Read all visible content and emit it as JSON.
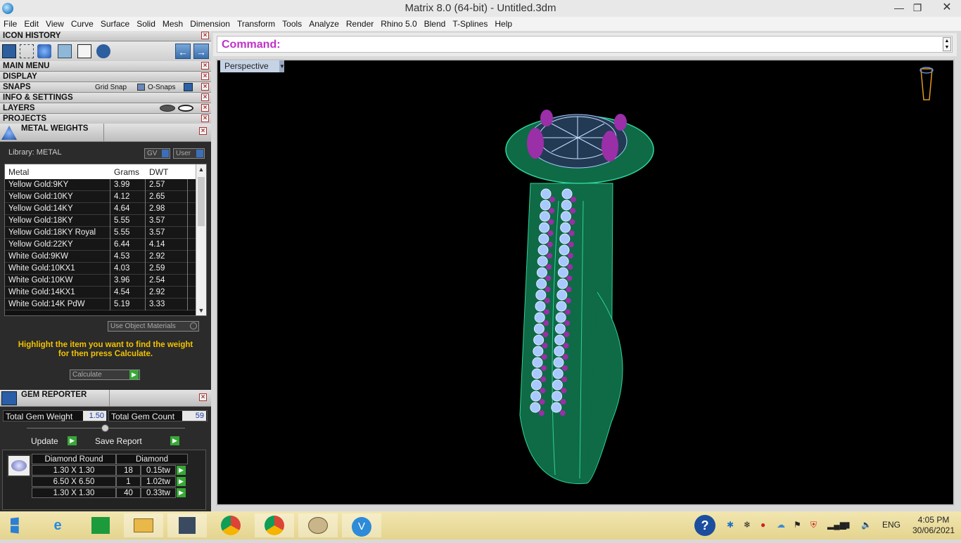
{
  "window": {
    "title": "Matrix 8.0 (64-bit) - Untitled.3dm"
  },
  "menu": [
    "File",
    "Edit",
    "View",
    "Curve",
    "Surface",
    "Solid",
    "Mesh",
    "Dimension",
    "Transform",
    "Tools",
    "Analyze",
    "Render",
    "Rhino 5.0",
    "Blend",
    "T-Splines",
    "Help"
  ],
  "panel": {
    "icon_history": "ICON HISTORY",
    "main_menu": "MAIN MENU",
    "display": "DISPLAY",
    "snaps": "SNAPS",
    "grid_snap": "Grid Snap",
    "o_snaps": "O-Snaps",
    "info_settings": "INFO & SETTINGS",
    "layers": "LAYERS",
    "projects": "PROJECTS"
  },
  "metal_weights": {
    "title": "METAL WEIGHTS",
    "library_label": "Library: METAL",
    "gv_btn": "GV",
    "user_btn": "User",
    "columns": [
      "Metal",
      "Grams",
      "DWT"
    ],
    "rows": [
      {
        "metal": "Yellow Gold:9KY",
        "grams": "3.99",
        "dwt": "2.57"
      },
      {
        "metal": "Yellow Gold:10KY",
        "grams": "4.12",
        "dwt": "2.65"
      },
      {
        "metal": "Yellow Gold:14KY",
        "grams": "4.64",
        "dwt": "2.98"
      },
      {
        "metal": "Yellow Gold:18KY",
        "grams": "5.55",
        "dwt": "3.57"
      },
      {
        "metal": "Yellow Gold:18KY Royal",
        "grams": "5.55",
        "dwt": "3.57"
      },
      {
        "metal": "Yellow Gold:22KY",
        "grams": "6.44",
        "dwt": "4.14"
      },
      {
        "metal": "White Gold:9KW",
        "grams": "4.53",
        "dwt": "2.92"
      },
      {
        "metal": "White Gold:10KX1",
        "grams": "4.03",
        "dwt": "2.59"
      },
      {
        "metal": "White Gold:10KW",
        "grams": "3.96",
        "dwt": "2.54"
      },
      {
        "metal": "White Gold:14KX1",
        "grams": "4.54",
        "dwt": "2.92"
      },
      {
        "metal": "White Gold:14K PdW",
        "grams": "5.19",
        "dwt": "3.33"
      }
    ],
    "use_object_materials": "Use Object Materials",
    "instructions": "Highlight the item you want to find the weight for then press Calculate.",
    "calculate": "Calculate"
  },
  "gem_reporter": {
    "title": "GEM REPORTER",
    "total_weight_label": "Total Gem Weight",
    "total_weight": "1.50",
    "total_count_label": "Total Gem Count",
    "total_count": "59",
    "update": "Update",
    "save_report": "Save Report",
    "header_shape": "Diamond Round",
    "header_type": "Diamond",
    "rows": [
      {
        "size": "1.30 X 1.30",
        "count": "18",
        "weight": "0.15tw"
      },
      {
        "size": "6.50 X 6.50",
        "count": "1",
        "weight": "1.02tw"
      },
      {
        "size": "1.30 X 1.30",
        "count": "40",
        "weight": "0.33tw"
      }
    ]
  },
  "command": {
    "label": "Command:"
  },
  "viewport": {
    "label": "Perspective"
  },
  "taskbar": {
    "lang": "ENG",
    "time": "4:05 PM",
    "date": "30/06/2021"
  },
  "colors": {
    "accent": "#c030c8",
    "ring_green": "#1f7a55",
    "gem_blue": "#a9c8ff",
    "gem_purple": "#9a2fa8"
  }
}
